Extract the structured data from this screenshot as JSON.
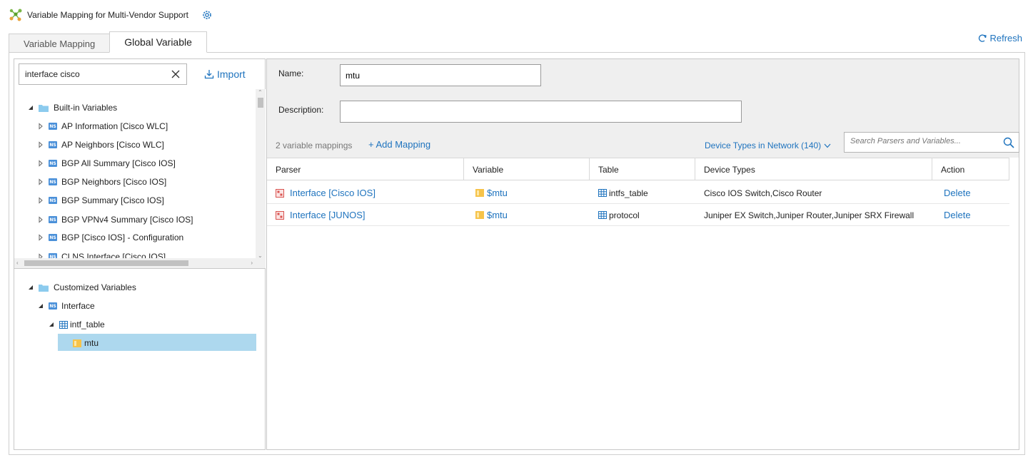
{
  "app": {
    "title": "Variable Mapping for Multi-Vendor Support",
    "refresh_label": "Refresh"
  },
  "tabs": [
    {
      "label": "Variable Mapping",
      "active": false
    },
    {
      "label": "Global Variable",
      "active": true
    }
  ],
  "left_panel": {
    "search_value": "interface cisco",
    "import_label": "Import",
    "builtin": {
      "label": "Built-in Variables",
      "items": [
        "AP Information [Cisco WLC]",
        "AP Neighbors [Cisco WLC]",
        "BGP All Summary [Cisco IOS]",
        "BGP Neighbors [Cisco IOS]",
        "BGP Summary [Cisco IOS]",
        "BGP VPNv4 Summary [Cisco IOS]",
        "BGP [Cisco IOS] - Configuration",
        "CLNS Interface [Cisco IOS]"
      ]
    },
    "customized": {
      "label": "Customized Variables",
      "parser": "Interface",
      "table": "intf_table",
      "variable": "mtu"
    }
  },
  "form": {
    "name_label": "Name:",
    "name_value": "mtu",
    "description_label": "Description:",
    "description_value": ""
  },
  "toolbar": {
    "count_text": "2 variable mappings",
    "add_mapping": "+ Add Mapping",
    "device_types": "Device Types in Network (140)",
    "search_placeholder": "Search Parsers and Variables..."
  },
  "table": {
    "headers": [
      "Parser",
      "Variable",
      "Table",
      "Device Types",
      "Action"
    ],
    "rows": [
      {
        "parser": "Interface [Cisco IOS]",
        "variable": "$mtu",
        "table": "intfs_table",
        "device_types": "Cisco IOS Switch,Cisco Router",
        "action": "Delete"
      },
      {
        "parser": "Interface [JUNOS]",
        "variable": "$mtu",
        "table": "protocol",
        "device_types": "Juniper EX Switch,Juniper Router,Juniper SRX Firewall",
        "action": "Delete"
      }
    ]
  },
  "colors": {
    "accent": "#1e73be",
    "selection": "#add8ee",
    "form_bg": "#efefef"
  }
}
